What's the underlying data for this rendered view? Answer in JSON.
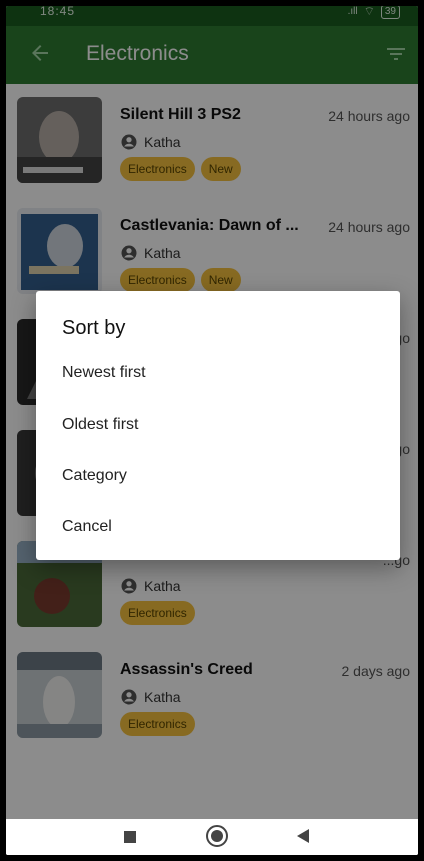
{
  "status_bar": {
    "time": "18:45",
    "signal": ".ıll",
    "wifi": "⌔",
    "battery": "39"
  },
  "app_bar": {
    "title": "Electronics"
  },
  "items": [
    {
      "title": "Silent Hill 3 PS2",
      "time": "24 hours ago",
      "user": "Katha",
      "chips": [
        "Electronics",
        "New"
      ]
    },
    {
      "title": "Castlevania: Dawn of ...",
      "time": "24 hours ago",
      "user": "Katha",
      "chips": [
        "Electronics",
        "New"
      ]
    },
    {
      "title": "",
      "time": "...go",
      "user": "",
      "chips": []
    },
    {
      "title": "",
      "time": "...go",
      "user": "",
      "chips": []
    },
    {
      "title": "",
      "time": "...go",
      "user": "Katha",
      "chips": [
        "Electronics"
      ]
    },
    {
      "title": "Assassin's Creed",
      "time": "2 days ago",
      "user": "Katha",
      "chips": [
        "Electronics"
      ]
    }
  ],
  "dialog": {
    "title": "Sort by",
    "options": [
      "Newest first",
      "Oldest first",
      "Category",
      "Cancel"
    ]
  },
  "colors": {
    "appbar": "#2e7d32",
    "statusbar": "#1b5e20",
    "chip": "#f6c23e"
  }
}
